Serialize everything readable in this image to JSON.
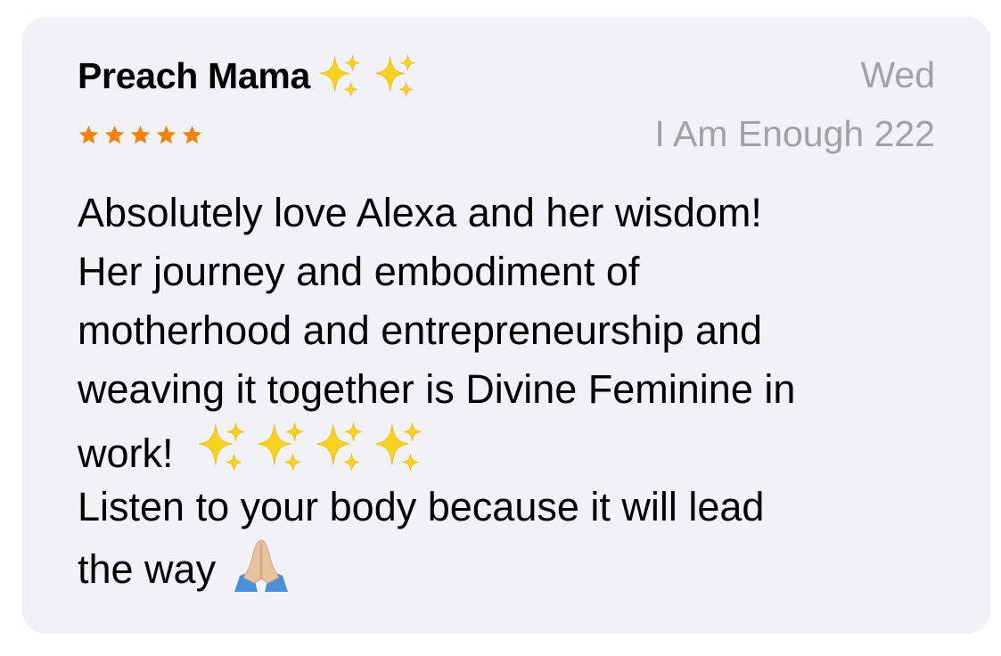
{
  "review": {
    "title": "Preach Mama",
    "title_emoji": [
      "sparkles-icon",
      "sparkles-icon"
    ],
    "date": "Wed",
    "rating": 5,
    "rating_max": 5,
    "star_color": "#f5820b",
    "author": "I Am Enough 222",
    "body_lines": [
      "Absolutely love Alexa and her wisdom!",
      "Her journey and embodiment of",
      "motherhood and entrepreneurship and",
      "weaving it together is Divine Feminine in",
      "work!",
      "Listen to your body because it will lead",
      "the way"
    ],
    "body_emoji": {
      "line_5": [
        "sparkles-icon",
        "sparkles-icon",
        "sparkles-icon",
        "sparkles-icon"
      ],
      "line_7": [
        "folded-hands-icon"
      ]
    }
  },
  "colors": {
    "card_background": "#f1f1f6",
    "secondary_text": "#a1a1a6",
    "primary_text": "#000000",
    "sparkle_yellow": "#f7d21e"
  }
}
